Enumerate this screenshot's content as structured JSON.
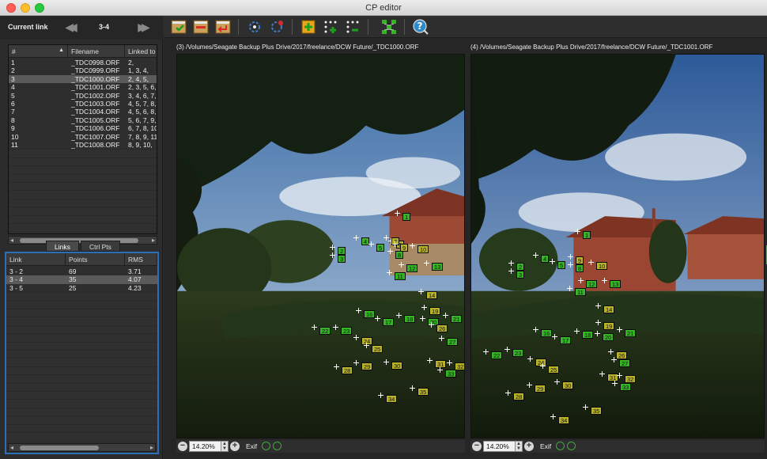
{
  "window": {
    "title": "CP editor"
  },
  "current_link": {
    "label": "Current link",
    "value": "3-4"
  },
  "image_table": {
    "columns": [
      "#",
      "Filename",
      "Linked to"
    ],
    "rows": [
      {
        "num": "1",
        "file": "_TDC0998.ORF",
        "linked": "2,"
      },
      {
        "num": "2",
        "file": "_TDC0999.ORF",
        "linked": "1, 3, 4,"
      },
      {
        "num": "3",
        "file": "_TDC1000.ORF",
        "linked": "2, 4, 5,"
      },
      {
        "num": "4",
        "file": "_TDC1001.ORF",
        "linked": "2, 3, 5, 6,"
      },
      {
        "num": "5",
        "file": "_TDC1002.ORF",
        "linked": "3, 4, 6, 7,"
      },
      {
        "num": "6",
        "file": "_TDC1003.ORF",
        "linked": "4, 5, 7, 8,"
      },
      {
        "num": "7",
        "file": "_TDC1004.ORF",
        "linked": "4, 5, 6, 8,"
      },
      {
        "num": "8",
        "file": "_TDC1005.ORF",
        "linked": "5, 6, 7, 9,"
      },
      {
        "num": "9",
        "file": "_TDC1006.ORF",
        "linked": "6, 7, 8, 10"
      },
      {
        "num": "10",
        "file": "_TDC1007.ORF",
        "linked": "7, 8, 9, 11,"
      },
      {
        "num": "11",
        "file": "_TDC1008.ORF",
        "linked": "8, 9, 10,"
      }
    ],
    "selected_index": 2
  },
  "tabs": [
    {
      "label": "Links"
    },
    {
      "label": "Ctrl Pts"
    }
  ],
  "link_table": {
    "columns": [
      "Link",
      "Points",
      "RMS"
    ],
    "rows": [
      {
        "link": "3 - 2",
        "points": "69",
        "rms": "3.71"
      },
      {
        "link": "3 - 4",
        "points": "35",
        "rms": "4.07"
      },
      {
        "link": "3 - 5",
        "points": "25",
        "rms": "4.23"
      }
    ],
    "selected_index": 1
  },
  "toolbar_icons": [
    "accept-icon",
    "delete-icon",
    "undo-icon",
    "network-icon",
    "network-settings-icon",
    "add-point-icon",
    "add-points-icon",
    "remove-points-icon",
    "graph-icon",
    "help-icon"
  ],
  "left_viewer": {
    "title": "(3) /Volumes/Seagate Backup Plus Drive/2017/freelance/DCW Future/_TDC1000.ORF",
    "zoom": "14.20%",
    "exif": "Exif"
  },
  "right_viewer": {
    "title": "(4) /Volumes/Seagate Backup Plus Drive/2017/freelance/DCW Future/_TDC1001.ORF",
    "zoom": "14.20%",
    "exif": "Exif"
  },
  "control_points_left": [
    {
      "label": "1",
      "color": "green"
    },
    {
      "label": "2",
      "color": "green"
    },
    {
      "label": "3",
      "color": "green"
    },
    {
      "label": "4",
      "color": "green"
    },
    {
      "label": "5",
      "color": "green"
    },
    {
      "label": "6",
      "color": "olive"
    },
    {
      "label": "7",
      "color": "olive"
    },
    {
      "label": "8",
      "color": "green"
    },
    {
      "label": "9",
      "color": "olive"
    },
    {
      "label": "10",
      "color": "olive"
    },
    {
      "label": "11",
      "color": "green"
    },
    {
      "label": "12",
      "color": "green"
    },
    {
      "label": "13",
      "color": "green"
    },
    {
      "label": "14",
      "color": "olive"
    },
    {
      "label": "16",
      "color": "green"
    },
    {
      "label": "17",
      "color": "green"
    },
    {
      "label": "18",
      "color": "green"
    },
    {
      "label": "19",
      "color": "olive"
    },
    {
      "label": "20",
      "color": "green"
    },
    {
      "label": "21",
      "color": "green"
    },
    {
      "label": "22",
      "color": "green"
    },
    {
      "label": "23",
      "color": "green"
    },
    {
      "label": "24",
      "color": "olive"
    },
    {
      "label": "25",
      "color": "olive"
    },
    {
      "label": "26",
      "color": "olive"
    },
    {
      "label": "27",
      "color": "green"
    },
    {
      "label": "28",
      "color": "olive"
    },
    {
      "label": "29",
      "color": "olive"
    },
    {
      "label": "30",
      "color": "olive"
    },
    {
      "label": "31",
      "color": "olive"
    },
    {
      "label": "32",
      "color": "olive"
    },
    {
      "label": "33",
      "color": "green"
    },
    {
      "label": "34",
      "color": "olive"
    },
    {
      "label": "35",
      "color": "olive"
    }
  ],
  "control_points_right": [
    {
      "label": "1",
      "color": "green"
    },
    {
      "label": "2",
      "color": "green"
    },
    {
      "label": "3",
      "color": "green"
    },
    {
      "label": "4",
      "color": "green"
    },
    {
      "label": "5",
      "color": "green"
    },
    {
      "label": "9",
      "color": "olive"
    },
    {
      "label": "8",
      "color": "green"
    },
    {
      "label": "10",
      "color": "olive"
    },
    {
      "label": "11",
      "color": "green"
    },
    {
      "label": "12",
      "color": "green"
    },
    {
      "label": "13",
      "color": "green"
    },
    {
      "label": "14",
      "color": "olive"
    },
    {
      "label": "16",
      "color": "green"
    },
    {
      "label": "17",
      "color": "green"
    },
    {
      "label": "18",
      "color": "green"
    },
    {
      "label": "19",
      "color": "olive"
    },
    {
      "label": "20",
      "color": "green"
    },
    {
      "label": "21",
      "color": "green"
    },
    {
      "label": "22",
      "color": "green"
    },
    {
      "label": "23",
      "color": "green"
    },
    {
      "label": "24",
      "color": "olive"
    },
    {
      "label": "25",
      "color": "olive"
    },
    {
      "label": "26",
      "color": "olive"
    },
    {
      "label": "27",
      "color": "green"
    },
    {
      "label": "28",
      "color": "olive"
    },
    {
      "label": "29",
      "color": "olive"
    },
    {
      "label": "30",
      "color": "olive"
    },
    {
      "label": "31",
      "color": "olive"
    },
    {
      "label": "32",
      "color": "olive"
    },
    {
      "label": "33",
      "color": "green"
    },
    {
      "label": "34",
      "color": "olive"
    },
    {
      "label": "35",
      "color": "olive"
    }
  ]
}
